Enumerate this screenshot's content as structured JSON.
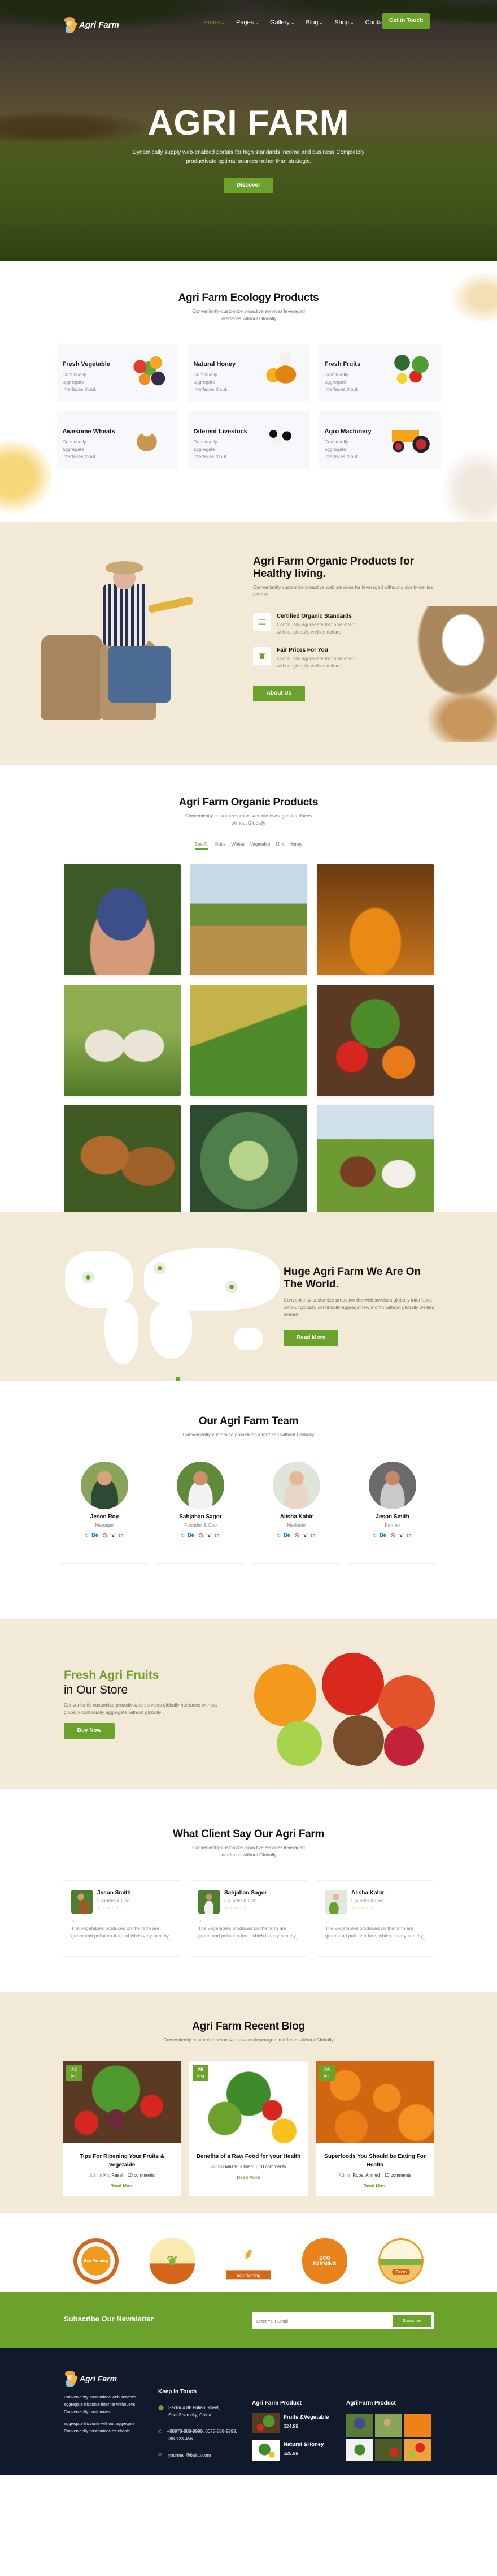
{
  "nav": {
    "brand": "Agri Farm",
    "menu": [
      {
        "label": "Home",
        "dropdown": true,
        "active": true
      },
      {
        "label": "Pages",
        "dropdown": true
      },
      {
        "label": "Gallery",
        "dropdown": true
      },
      {
        "label": "Blog",
        "dropdown": true
      },
      {
        "label": "Shop",
        "dropdown": true
      },
      {
        "label": "Contact",
        "dropdown": false
      }
    ],
    "cta": "Get in Touch",
    "chevron": "⌄"
  },
  "hero": {
    "title": "AGRI FARM",
    "subtitle": "Dynamically supply web-enabled portals for high standards income and business Completely productivate optimal sources rather than strategic.",
    "button": "Discover"
  },
  "ecology": {
    "title": "Agri Farm Ecology Products",
    "subtitle": "Conveniently customize proactive services leveraged interfaces without Globally",
    "items": [
      {
        "title": "Fresh Vegetable",
        "text": "Continually aggregate interfaces thout.",
        "image": "vegetables"
      },
      {
        "title": "Natural Honey",
        "text": "Continually aggregate interfaces thout.",
        "image": "honey-jar"
      },
      {
        "title": "Fresh Fruits",
        "text": "Continually aggregate interfaces thout.",
        "image": "fruits"
      },
      {
        "title": "Awesome Wheats",
        "text": "Continually aggregate interfaces thout.",
        "image": "flour-sack"
      },
      {
        "title": "Diferent Livestock",
        "text": "Continually aggregate interfaces thout.",
        "image": "cow"
      },
      {
        "title": "Agro Machinery",
        "text": "Continually aggregate interfaces thout.",
        "image": "tractor"
      }
    ]
  },
  "healthy": {
    "title": "Agri Farm Organic Products for Healthy living.",
    "lead": "Conveniently customize proactive web services for leveraged without globally wellies richard.",
    "features": [
      {
        "icon": "certificate-icon",
        "glyph": "▤",
        "title": "Certified Organic Standards",
        "text": "Continually aggregate frictionle interc without globally wellies richard."
      },
      {
        "icon": "wallet-icon",
        "glyph": "▣",
        "title": "Fair Prices For You",
        "text": "Continually aggregate frictionle interc without globally wellies richard."
      }
    ],
    "button": "About Us"
  },
  "gallery": {
    "title": "Agri Farm Organic Products",
    "subtitle": "Conveniently customize proactives into everaged interfaces without Globally",
    "tabs": [
      {
        "label": "See All",
        "active": true
      },
      {
        "label": "Fruits"
      },
      {
        "label": "Wheat"
      },
      {
        "label": "Vegetable"
      },
      {
        "label": "Milk"
      },
      {
        "label": "Honey"
      }
    ],
    "items": [
      "blueberries",
      "tractor-field",
      "honey",
      "sheep",
      "rice-plant",
      "vegetables-basket",
      "chickens",
      "cabbage",
      "cows-pasture"
    ]
  },
  "world": {
    "title": "Huge Agri Farm We Are On The World.",
    "text": "Conveniently customize proactive the web services globally interfaces without globally continually aggregat few month without globally wellies richard.",
    "button": "Read More"
  },
  "team": {
    "title": "Our Agri Farm Team",
    "subtitle": "Conveniently customize proactives interfaces without Globally",
    "members": [
      {
        "name": "Jeson Roy",
        "role": "Manager"
      },
      {
        "name": "Sahjahan Sagor",
        "role": "Founder & Ceo"
      },
      {
        "name": "Alisha Kabir",
        "role": "Marketer"
      },
      {
        "name": "Jeson Smith",
        "role": "Farmer"
      }
    ],
    "socials": [
      {
        "name": "twitter-icon",
        "glyph": "🐦︎",
        "label": "t",
        "color": "#1da1f2"
      },
      {
        "name": "behance-icon",
        "label": "Bē",
        "color": "#1769ff"
      },
      {
        "name": "instagram-icon",
        "label": "◎",
        "color": "#e1306c"
      },
      {
        "name": "vimeo-icon",
        "label": "v",
        "color": "#1a2d6b"
      },
      {
        "name": "linkedin-icon",
        "label": "in",
        "color": "#0a66c2"
      }
    ]
  },
  "fresh": {
    "title": "Fresh Agri Fruits",
    "subtitle": "in Our Store",
    "text": "Conveniently customize proactiv web services globally nterfaces without globally continually aggregate without globally .",
    "button": "Buy Now"
  },
  "testimonials": {
    "title": "What Client Say Our Agri Farm",
    "subtitle": "Conveniently customize proactive services leveraged interfaces without Globally",
    "items": [
      {
        "name": "Jeson Smith",
        "role": "Founder & Ceo",
        "rating": 5,
        "text": "The vegetables produced on the farm are green and pollution-free, which is very healthy"
      },
      {
        "name": "Sahjahan Sagor",
        "role": "Founder & Ceo",
        "rating": 5,
        "text": "The vegetables produced on the farm are green and pollution-free, which is very healthy"
      },
      {
        "name": "Alisha Kabir",
        "role": "Founder & Ceo",
        "rating": 5,
        "text": "The vegetables produced on the farm are green and pollution-free, which is very healthy"
      }
    ],
    "star": "☆☆☆☆☆"
  },
  "blog": {
    "title": "Agri Farm Recent Blog",
    "subtitle": "Conveniently customize proactive services leveraged interfaces without Globally",
    "posts": [
      {
        "day": "24",
        "month": "Aug",
        "title": "Tips For Ripening Your Fruits & Vegetable",
        "admin": "Admin",
        "author": "Kh. Rasel",
        "comments": "10 comments",
        "read": "Read More"
      },
      {
        "day": "25",
        "month": "Aug",
        "title": "Benefits of a Raw Food for your Health",
        "admin": "Admin",
        "author": "Mazadul Islam",
        "comments": "10 comments",
        "read": "Read More"
      },
      {
        "day": "26",
        "month": "Aug",
        "title": "Superfoods You Should be Eating For Health",
        "admin": "Admin",
        "author": "Rubal Ahmed",
        "comments": "10 comments",
        "read": "Read More"
      }
    ]
  },
  "partners": [
    {
      "name": "eco-farming-hen-badge",
      "label": "Eco Farming"
    },
    {
      "name": "sprout-badge",
      "label": ""
    },
    {
      "name": "wheat-badge",
      "label": "eco farming"
    },
    {
      "name": "pumpkin-badge",
      "label": "ECO FARMING"
    },
    {
      "name": "farm-barn-badge",
      "label": "Farm"
    }
  ],
  "newsletter": {
    "title": "Subscribe Our Newsletter",
    "placeholder": "Enter Your Email",
    "button": "Subscribe"
  },
  "footer": {
    "brand": "Agri Farm",
    "about1": "Conveniently customizec web services aggregate frictionle internet withouevs Conveniently customizec.",
    "about2": "aggregate frictionle without aggregate Conveniently customizec efrictionle.",
    "contact_title": "Keep In Touch",
    "address": "Sector # 88 Futian Street, ShenZhen city, China",
    "phone": "+88978-888-9999, 0078-888-9999, +88-123-456",
    "email": "yourmail@baidu.com",
    "products_title": "Agri Farm Product",
    "products": [
      {
        "name": "Fruits &Vegetable",
        "price": "$24.99"
      },
      {
        "name": "Natural &Honey",
        "price": "$25.99"
      }
    ],
    "gallery_title": "Agri Farm Product"
  },
  "colors": {
    "accent": "#6aa22c",
    "cream": "#f2e9d6",
    "footer": "#111a2b"
  }
}
